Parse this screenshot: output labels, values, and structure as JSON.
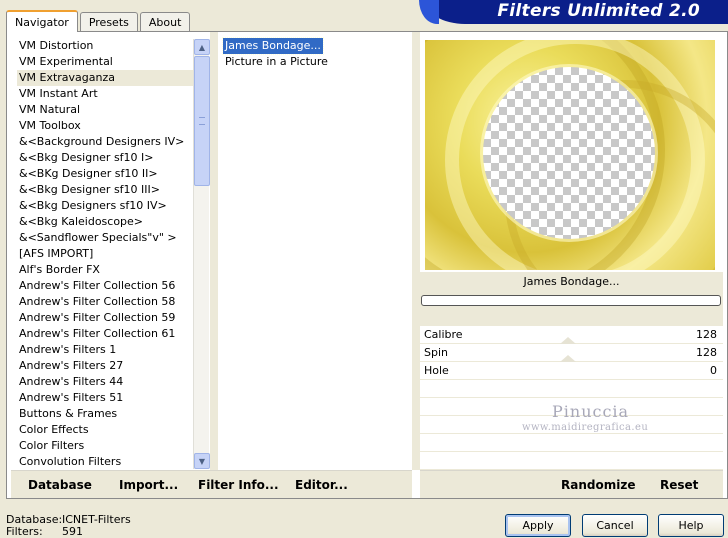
{
  "tabs": [
    {
      "label": "Navigator",
      "active": true
    },
    {
      "label": "Presets",
      "active": false
    },
    {
      "label": "About",
      "active": false
    }
  ],
  "banner": {
    "title": "Filters Unlimited 2.0"
  },
  "categories": {
    "items": [
      "VM Distortion",
      "VM Experimental",
      "VM Extravaganza",
      "VM Instant Art",
      "VM Natural",
      "VM Toolbox",
      "&<Background Designers IV>",
      "&<Bkg Designer sf10 I>",
      "&<BKg Designer sf10 II>",
      "&<Bkg Designer sf10 III>",
      "&<Bkg Designers sf10 IV>",
      "&<Bkg Kaleidoscope>",
      "&<Sandflower Specials\"v\" >",
      "[AFS IMPORT]",
      "Alf's Border FX",
      "Andrew's Filter Collection 56",
      "Andrew's Filter Collection 58",
      "Andrew's Filter Collection 59",
      "Andrew's Filter Collection 61",
      "Andrew's Filters 1",
      "Andrew's Filters 27",
      "Andrew's Filters 44",
      "Andrew's Filters 51",
      "Buttons & Frames",
      "Color Effects",
      "Color Filters",
      "Convolution Filters"
    ],
    "selected_index": 2
  },
  "effects": {
    "items": [
      "James Bondage...",
      "Picture in a Picture"
    ],
    "selected_index": 0
  },
  "preview": {
    "filter_name": "James Bondage..."
  },
  "progress": {
    "value": 0
  },
  "params": [
    {
      "label": "Calibre",
      "value": "128"
    },
    {
      "label": "Spin",
      "value": "128"
    },
    {
      "label": "Hole",
      "value": "0"
    }
  ],
  "watermark": {
    "name": "Pinuccia",
    "url": "www.maidiregrafica.eu"
  },
  "toolbar": {
    "database": "Database",
    "import": "Import...",
    "filter_info": "Filter Info...",
    "editor": "Editor...",
    "randomize": "Randomize",
    "reset": "Reset"
  },
  "status": {
    "database_label": "Database:",
    "database_value": "ICNET-Filters",
    "filters_label": "Filters:",
    "filters_value": "591"
  },
  "dialog": {
    "apply": "Apply",
    "cancel": "Cancel",
    "help": "Help"
  },
  "colors": {
    "banner": "#0b1f8a",
    "selection": "#316ac5",
    "panel": "#ece9d8"
  }
}
